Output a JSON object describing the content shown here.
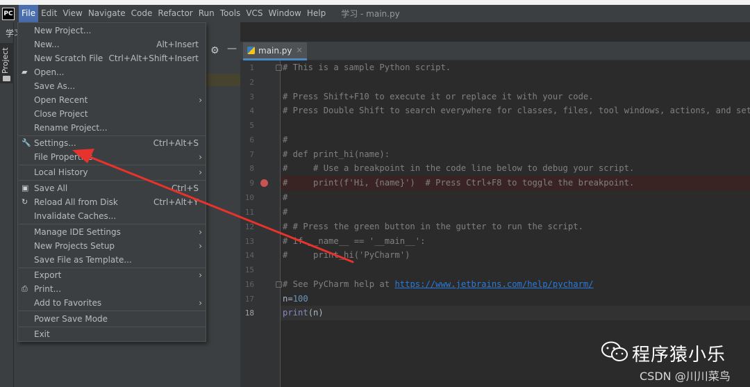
{
  "menubar": {
    "logo": "PC",
    "items": [
      {
        "label": "File",
        "active": true
      },
      {
        "label": "Edit"
      },
      {
        "label": "View"
      },
      {
        "label": "Navigate"
      },
      {
        "label": "Code"
      },
      {
        "label": "Refactor"
      },
      {
        "label": "Run"
      },
      {
        "label": "Tools"
      },
      {
        "label": "VCS"
      },
      {
        "label": "Window"
      },
      {
        "label": "Help"
      }
    ],
    "window_title": "学习 - main.py"
  },
  "sidebar": {
    "project_tab": "Project",
    "breadcrumb_root": "学习"
  },
  "file_menu": {
    "items": [
      {
        "label": "New Project...",
        "shortcut": ""
      },
      {
        "label": "New...",
        "shortcut": "Alt+Insert"
      },
      {
        "label": "New Scratch File",
        "shortcut": "Ctrl+Alt+Shift+Insert"
      },
      {
        "label": "Open...",
        "shortcut": ""
      },
      {
        "label": "Save As...",
        "shortcut": ""
      },
      {
        "label": "Open Recent",
        "shortcut": ""
      },
      {
        "label": "Close Project",
        "shortcut": ""
      },
      {
        "label": "Rename Project...",
        "shortcut": ""
      },
      {
        "label": "Settings...",
        "shortcut": "Ctrl+Alt+S"
      },
      {
        "label": "File Properties",
        "shortcut": ""
      },
      {
        "label": "Local History",
        "shortcut": ""
      },
      {
        "label": "Save All",
        "shortcut": "Ctrl+S"
      },
      {
        "label": "Reload All from Disk",
        "shortcut": "Ctrl+Alt+Y"
      },
      {
        "label": "Invalidate Caches...",
        "shortcut": ""
      },
      {
        "label": "Manage IDE Settings",
        "shortcut": ""
      },
      {
        "label": "New Projects Setup",
        "shortcut": ""
      },
      {
        "label": "Save File as Template...",
        "shortcut": ""
      },
      {
        "label": "Export",
        "shortcut": ""
      },
      {
        "label": "Print...",
        "shortcut": ""
      },
      {
        "label": "Add to Favorites",
        "shortcut": ""
      },
      {
        "label": "Power Save Mode",
        "shortcut": ""
      },
      {
        "label": "Exit",
        "shortcut": ""
      }
    ]
  },
  "editor": {
    "tab_label": "main.py",
    "current_line": 18,
    "breakpoint_line": 9,
    "lines": [
      {
        "n": "1",
        "text": "# This is a sample Python script."
      },
      {
        "n": "2",
        "text": ""
      },
      {
        "n": "3",
        "text": "# Press Shift+F10 to execute it or replace it with your code."
      },
      {
        "n": "4",
        "text": "# Press Double Shift to search everywhere for classes, files, tool windows, actions, and settings."
      },
      {
        "n": "5",
        "text": ""
      },
      {
        "n": "6",
        "text": "#"
      },
      {
        "n": "7",
        "text": "# def print_hi(name):"
      },
      {
        "n": "8",
        "text": "#     # Use a breakpoint in the code line below to debug your script."
      },
      {
        "n": "9",
        "text": "#     print(f'Hi, {name}')  # Press Ctrl+F8 to toggle the breakpoint."
      },
      {
        "n": "10",
        "text": "#"
      },
      {
        "n": "11",
        "text": "#"
      },
      {
        "n": "12",
        "text": "# # Press the green button in the gutter to run the script."
      },
      {
        "n": "13",
        "text": "# if __name__ == '__main__':"
      },
      {
        "n": "14",
        "text": "#     print_hi('PyCharm')"
      },
      {
        "n": "15",
        "text": ""
      },
      {
        "n": "16",
        "text": "# See PyCharm help at ",
        "link": "https://www.jetbrains.com/help/pycharm/"
      },
      {
        "n": "17",
        "text": "n=",
        "number": "100"
      },
      {
        "n": "18",
        "builtin": "print",
        "text": "(n)"
      }
    ]
  },
  "watermark": {
    "title": "程序猿小乐",
    "subtitle": "CSDN @川川菜鸟"
  },
  "colors": {
    "menu_highlight": "#4b6eaf",
    "annotation_arrow": "#e8322d",
    "breakpoint": "#c75450"
  }
}
